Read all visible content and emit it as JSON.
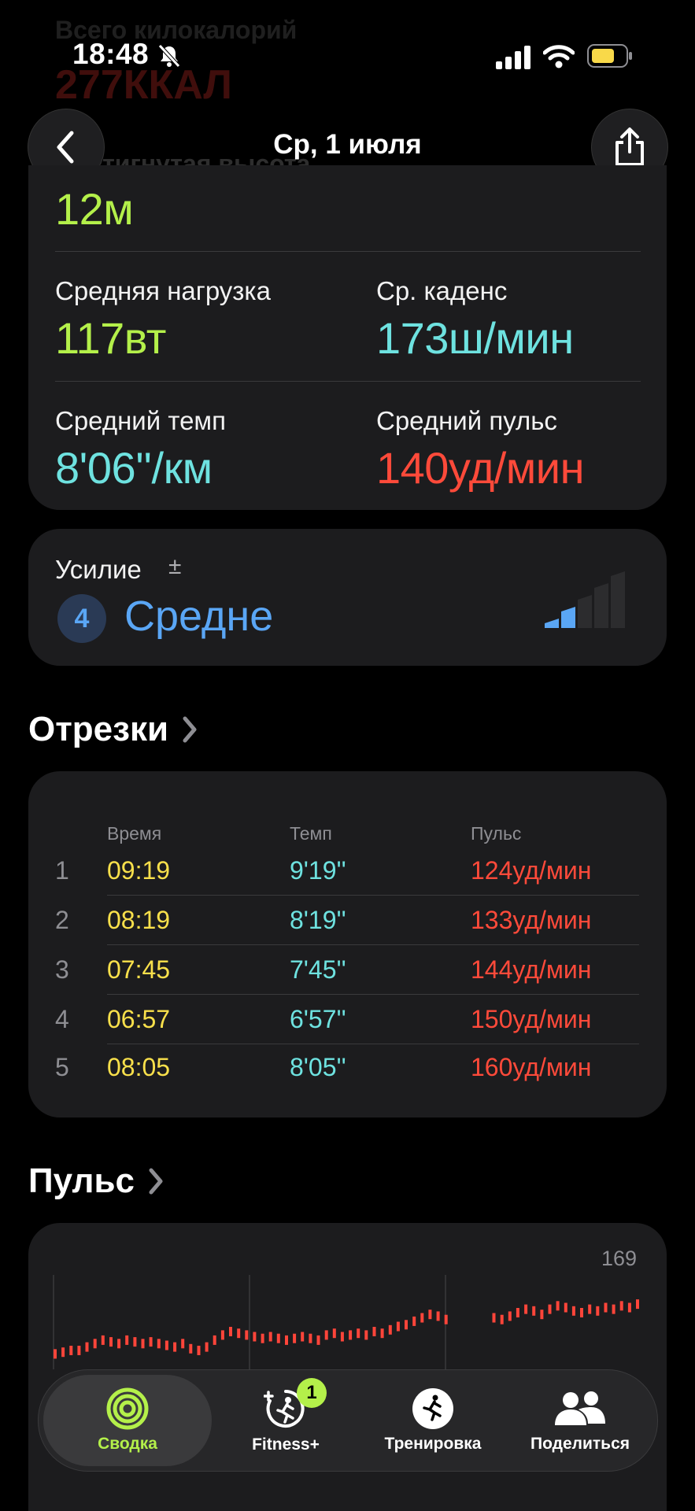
{
  "status_bar": {
    "time": "18:48",
    "icons": [
      "bell-slash-icon",
      "signal-icon",
      "wifi-icon",
      "battery-icon"
    ]
  },
  "ghost_text": {
    "top_label": "Всего килокалорий",
    "top_value": "277ККАЛ",
    "elev_label": "Достигнутая высота"
  },
  "nav": {
    "title": "Ср, 1 июля",
    "back_icon": "chevron-left-icon",
    "share_icon": "share-icon"
  },
  "metrics": {
    "elevation_value": "12м",
    "power_label": "Средняя нагрузка",
    "power_value": "117вт",
    "cadence_label": "Ср. каденс",
    "cadence_value": "173ш/мин",
    "pace_label": "Средний темп",
    "pace_value": "8'06''/км",
    "hr_label": "Средний пульс",
    "hr_value": "140уд/мин"
  },
  "effort": {
    "label": "Усилие",
    "plus_minus": "±",
    "level": "4",
    "value": "Средне",
    "bars_filled": 2,
    "bars_total": 5
  },
  "splits": {
    "title": "Отрезки",
    "headers": {
      "time": "Время",
      "pace": "Темп",
      "hr": "Пульс"
    },
    "rows": [
      {
        "idx": "1",
        "time": "09:19",
        "pace": "9'19''",
        "hr": "124уд/мин"
      },
      {
        "idx": "2",
        "time": "08:19",
        "pace": "8'19''",
        "hr": "133уд/мин"
      },
      {
        "idx": "3",
        "time": "07:45",
        "pace": "7'45''",
        "hr": "144уд/мин"
      },
      {
        "idx": "4",
        "time": "06:57",
        "pace": "6'57''",
        "hr": "150уд/мин"
      },
      {
        "idx": "5",
        "time": "08:05",
        "pace": "8'05''",
        "hr": "160уд/мин"
      }
    ]
  },
  "heart_rate": {
    "title": "Пульс",
    "chart_data": {
      "type": "scatter",
      "max_label": "169",
      "color": "#ff453a",
      "values": [
        124,
        125,
        126,
        126,
        128,
        130,
        132,
        131,
        130,
        132,
        131,
        130,
        131,
        130,
        129,
        128,
        130,
        127,
        126,
        128,
        132,
        135,
        137,
        136,
        135,
        134,
        133,
        134,
        133,
        132,
        133,
        134,
        133,
        132,
        135,
        136,
        134,
        135,
        136,
        135,
        137,
        136,
        138,
        140,
        141,
        143,
        145,
        147,
        146,
        144,
        143,
        147,
        146,
        144,
        142,
        145,
        144,
        146,
        148,
        150,
        149,
        147,
        150,
        152,
        151,
        149,
        148,
        150,
        149,
        151,
        150,
        152,
        151,
        153
      ]
    }
  },
  "tabbar": {
    "tabs": [
      {
        "label": "Сводка",
        "icon": "activity-rings-icon",
        "active": true
      },
      {
        "label": "Fitness+",
        "icon": "fitness-plus-icon",
        "badge": "1"
      },
      {
        "label": "Тренировка",
        "icon": "running-figure-icon"
      },
      {
        "label": "Поделиться",
        "icon": "people-icon"
      }
    ]
  }
}
